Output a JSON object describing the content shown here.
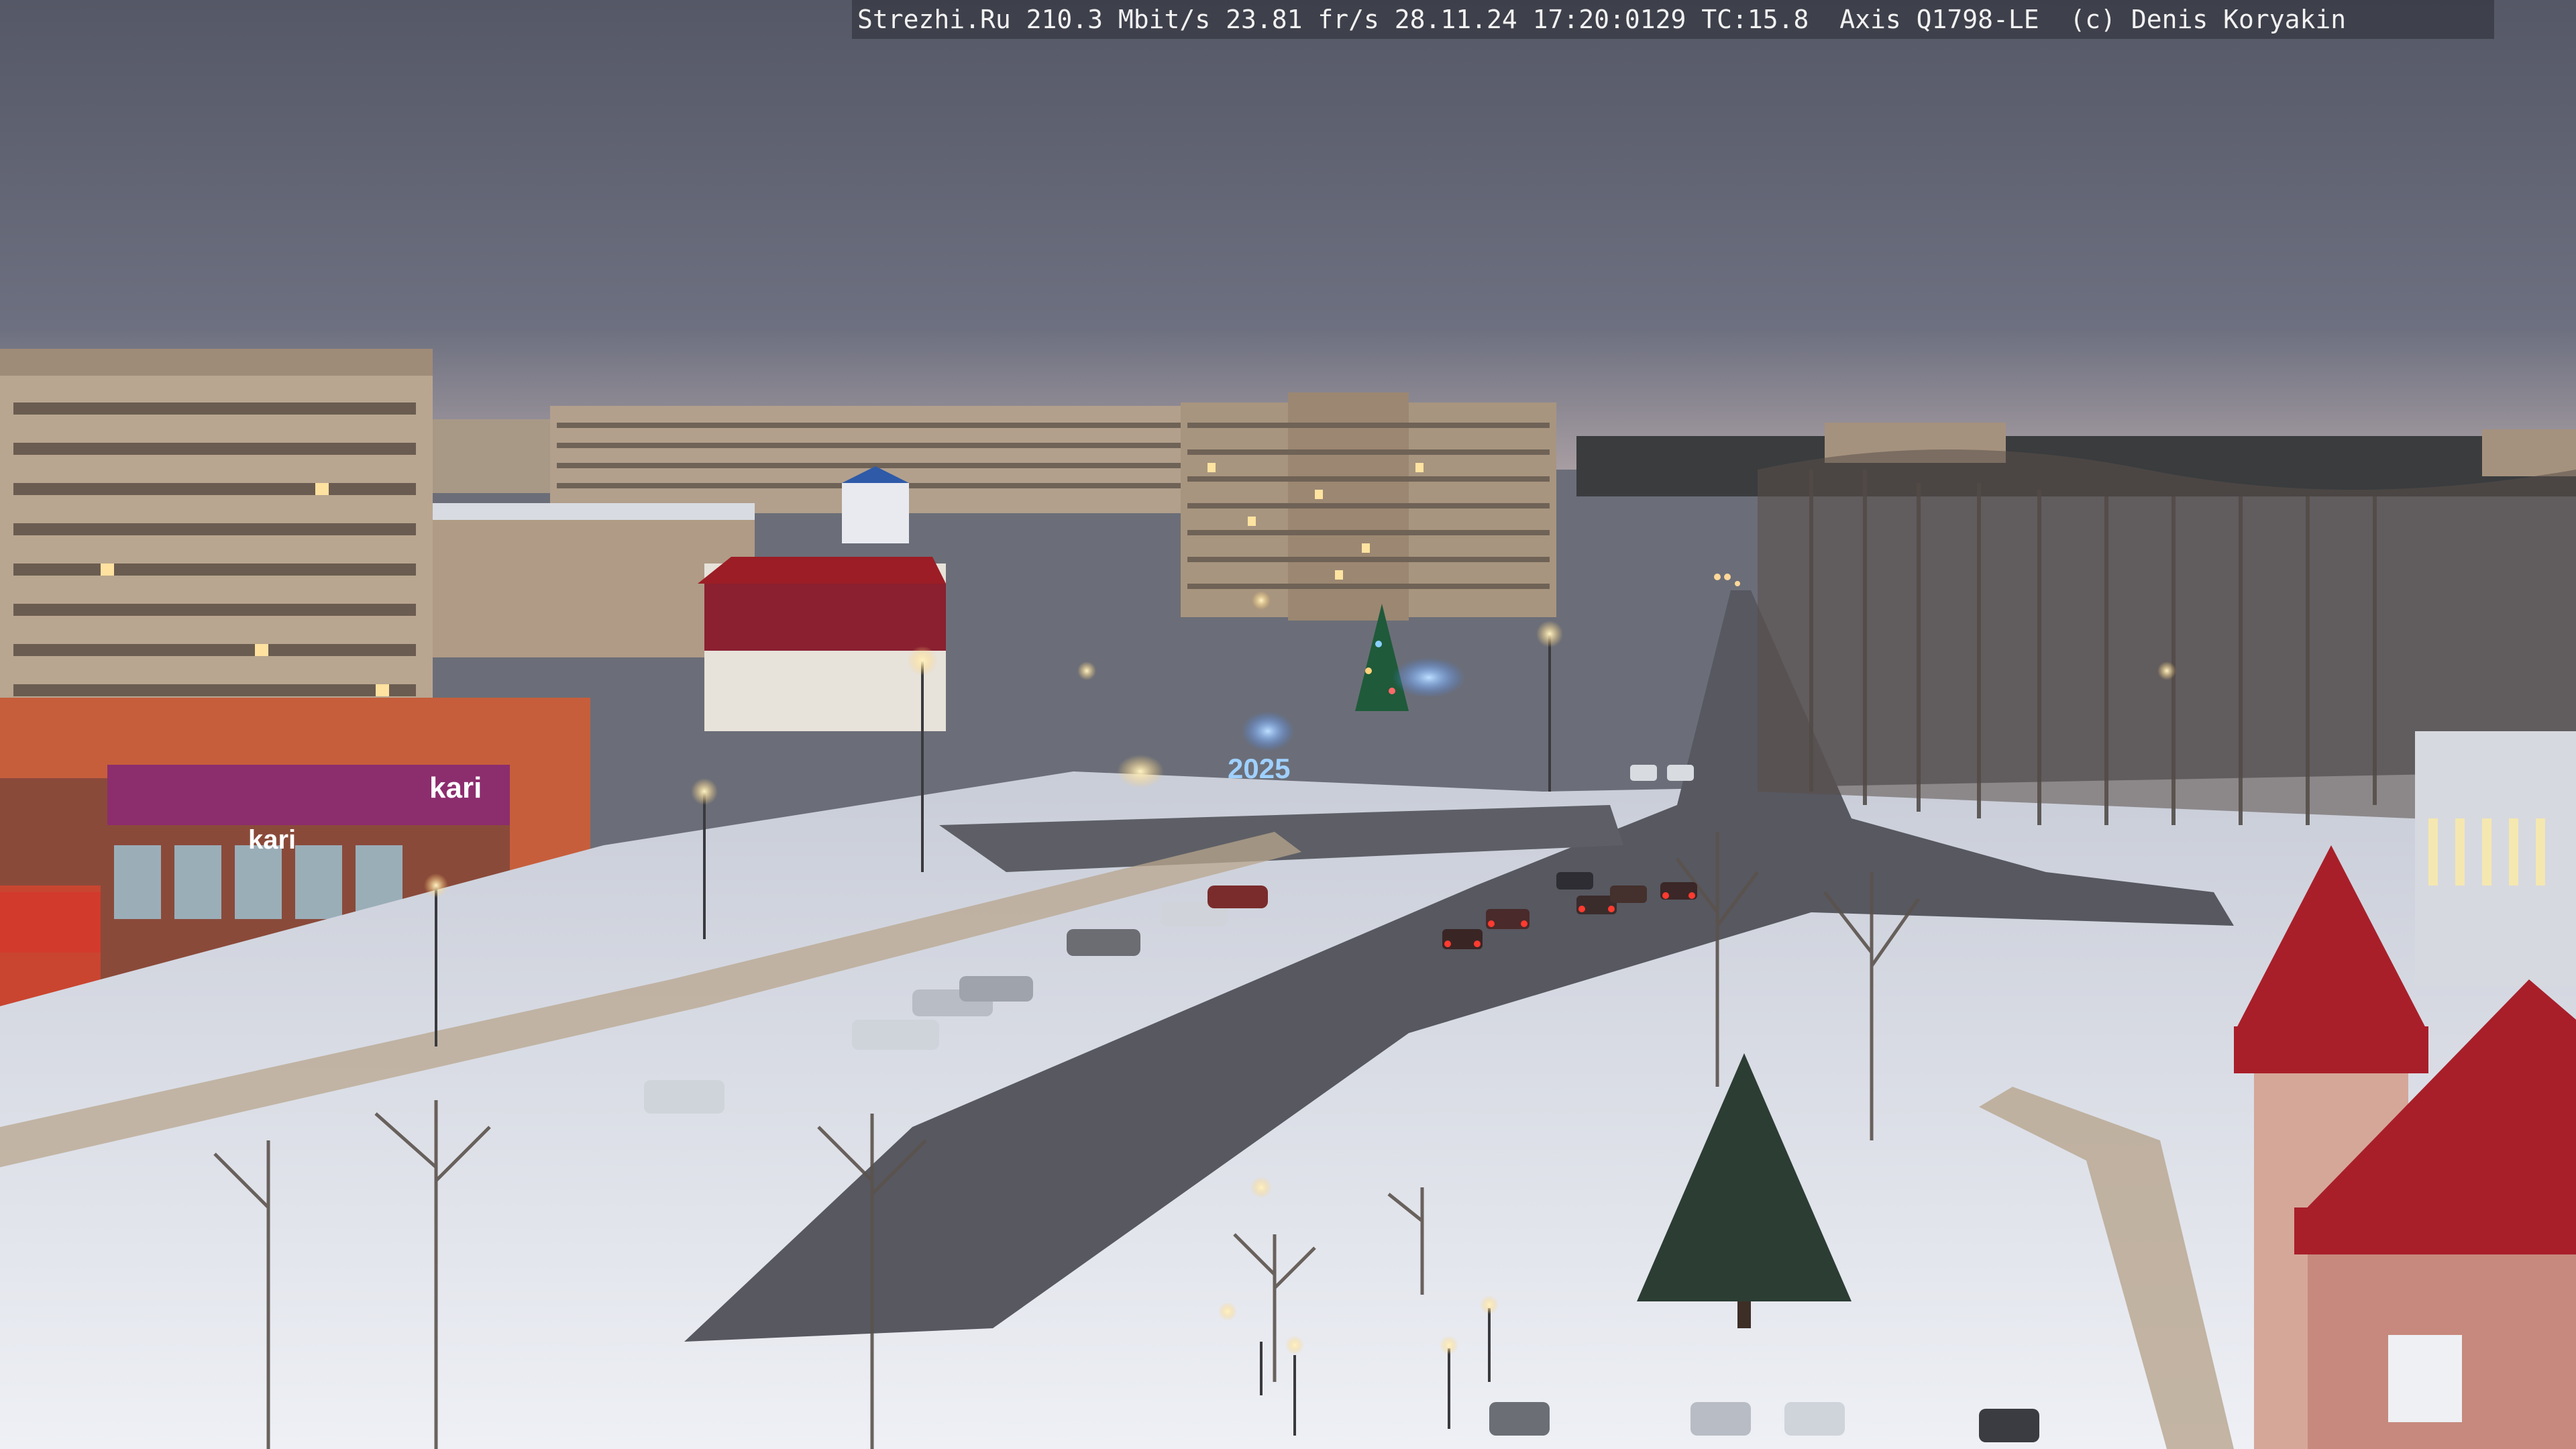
{
  "overlay": {
    "caption": "Strezhi.Ru 210.3 Mbit/s 23.81 fr/s 28.11.24 17:20:0129 TC:15.8  Axis Q1798-LE  (c) Denis Koryakin"
  },
  "signs": {
    "store_logo_top": "kari",
    "store_logo_side": "kari",
    "year_display": "2025"
  },
  "colors": {
    "sky": "#5f6270",
    "snow": "#e3e6ee",
    "road": "#5a5a60",
    "panel_building": "#b7a48f",
    "storefront": "#c45a3a",
    "kari_sign": "#8c2d6e",
    "roof_red": "#a81f2a",
    "tree_dark": "#3b3a36",
    "street_light": "#ffd27a",
    "festive_blue": "#5aa0ff"
  }
}
